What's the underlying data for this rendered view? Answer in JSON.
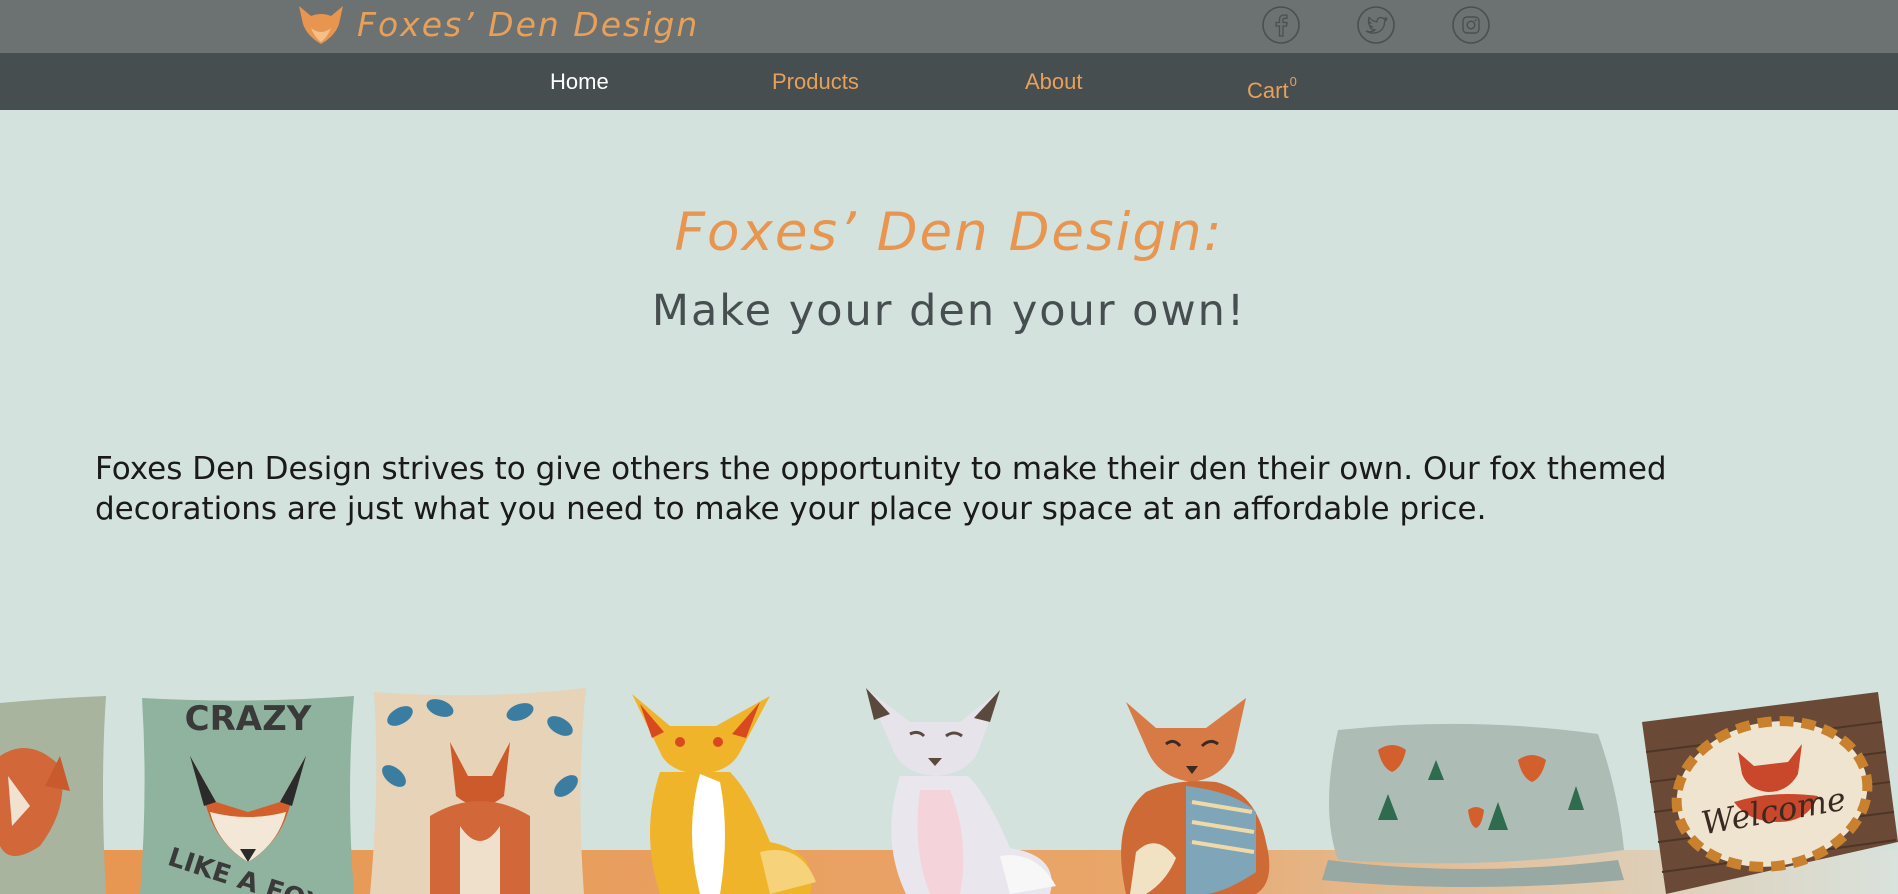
{
  "header": {
    "brand_name": "Foxes’ Den Design",
    "social": [
      "facebook-icon",
      "twitter-icon",
      "instagram-icon"
    ]
  },
  "nav": {
    "items": [
      {
        "label": "Home",
        "active": true
      },
      {
        "label": "Products",
        "active": false
      },
      {
        "label": "About",
        "active": false
      },
      {
        "label": "Cart",
        "active": false
      }
    ],
    "cart_count": "0"
  },
  "hero": {
    "title": "Foxes’ Den Design:",
    "subtitle": "Make your den your own!"
  },
  "intro": {
    "text": "Foxes Den Design strives to give others the opportunity to make their den their own. Our fox themed decorations are just what you need to make your place your space at an affordable price."
  },
  "products_strip": {
    "pillow_text_top": "CRAZY",
    "pillow_text_bottom": "LIKE A FOX",
    "doormat_text": "Welcome"
  },
  "colors": {
    "accent": "#e7a05a",
    "topbar": "#6c7171",
    "navbar": "#474e50",
    "background": "#d4e2de",
    "subtitle": "#474e50"
  }
}
